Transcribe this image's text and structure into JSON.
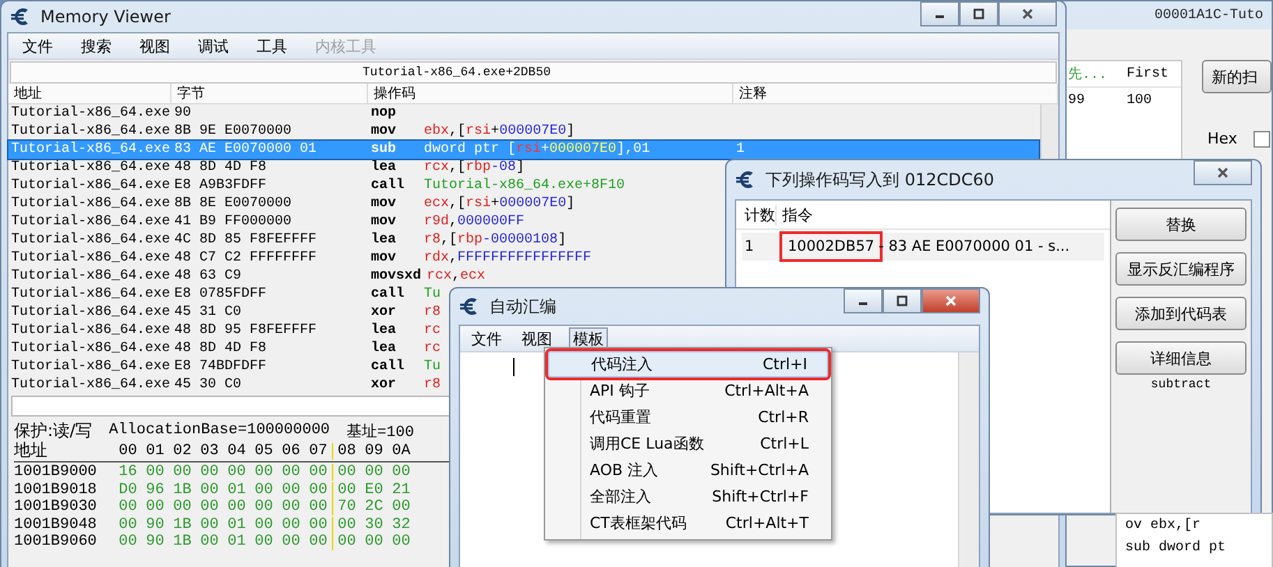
{
  "background_window": {
    "title": "00001A1C-Tuto",
    "columns": [
      "先...",
      "First"
    ],
    "row": [
      "99",
      "100"
    ],
    "button": "新的扫",
    "hex_label": "Hex",
    "hex_checked": false,
    "code_lines": [
      "ov ebx,[r",
      "sub dword pt"
    ]
  },
  "memory_viewer": {
    "title": "Memory Viewer",
    "menu": [
      {
        "label": "文件",
        "disabled": false
      },
      {
        "label": "搜索",
        "disabled": false
      },
      {
        "label": "视图",
        "disabled": false
      },
      {
        "label": "调试",
        "disabled": false
      },
      {
        "label": "工具",
        "disabled": false
      },
      {
        "label": "内核工具",
        "disabled": true
      }
    ],
    "location": "Tutorial-x86_64.exe+2DB50",
    "columns": [
      "地址",
      "字节",
      "操作码",
      "注释"
    ],
    "rows": [
      {
        "address": "Tutorial-x86_64.exe",
        "bytes": "90",
        "opcode": "nop",
        "operand": [],
        "comment": "",
        "selected": false
      },
      {
        "address": "Tutorial-x86_64.exe",
        "bytes": "8B 9E E0070000",
        "opcode": "mov",
        "operand": [
          {
            "text": "ebx",
            "kind": "reg"
          },
          {
            "text": ",[",
            "kind": "plain"
          },
          {
            "text": "rsi",
            "kind": "reg"
          },
          {
            "text": "+",
            "kind": "plain"
          },
          {
            "text": "000007E0",
            "kind": "num"
          },
          {
            "text": "]",
            "kind": "plain"
          }
        ],
        "comment": "",
        "selected": false
      },
      {
        "address": "Tutorial-x86_64.exe",
        "bytes": "83 AE E0070000 01",
        "opcode": "sub",
        "operand": [
          {
            "text": "dword ptr [",
            "kind": "plain"
          },
          {
            "text": "rsi",
            "kind": "reg"
          },
          {
            "text": "+",
            "kind": "plain"
          },
          {
            "text": "000007E0",
            "kind": "num"
          },
          {
            "text": "],01",
            "kind": "plain"
          }
        ],
        "comment": "1",
        "selected": true
      },
      {
        "address": "Tutorial-x86_64.exe",
        "bytes": "48 8D 4D F8",
        "opcode": "lea",
        "operand": [
          {
            "text": "rcx",
            "kind": "reg"
          },
          {
            "text": ",[",
            "kind": "plain"
          },
          {
            "text": "rbp",
            "kind": "reg"
          },
          {
            "text": "-08",
            "kind": "num"
          },
          {
            "text": "]",
            "kind": "plain"
          }
        ],
        "comment": "",
        "selected": false
      },
      {
        "address": "Tutorial-x86_64.exe",
        "bytes": "E8 A9B3FDFF",
        "opcode": "call",
        "operand": [
          {
            "text": "Tutorial-x86_64.exe+8F10",
            "kind": "sym"
          }
        ],
        "comment": "",
        "selected": false
      },
      {
        "address": "Tutorial-x86_64.exe",
        "bytes": "8B 8E E0070000",
        "opcode": "mov",
        "operand": [
          {
            "text": "ecx",
            "kind": "reg"
          },
          {
            "text": ",[",
            "kind": "plain"
          },
          {
            "text": "rsi",
            "kind": "reg"
          },
          {
            "text": "+",
            "kind": "plain"
          },
          {
            "text": "000007E0",
            "kind": "num"
          },
          {
            "text": "]",
            "kind": "plain"
          }
        ],
        "comment": "",
        "selected": false
      },
      {
        "address": "Tutorial-x86_64.exe",
        "bytes": "41 B9 FF000000",
        "opcode": "mov",
        "operand": [
          {
            "text": "r9d",
            "kind": "reg"
          },
          {
            "text": ",",
            "kind": "plain"
          },
          {
            "text": "000000FF",
            "kind": "num"
          }
        ],
        "comment": "",
        "selected": false
      },
      {
        "address": "Tutorial-x86_64.exe",
        "bytes": "4C 8D 85 F8FEFFFF",
        "opcode": "lea",
        "operand": [
          {
            "text": "r8",
            "kind": "reg"
          },
          {
            "text": ",[",
            "kind": "plain"
          },
          {
            "text": "rbp",
            "kind": "reg"
          },
          {
            "text": "-00000108",
            "kind": "num"
          },
          {
            "text": "]",
            "kind": "plain"
          }
        ],
        "comment": "",
        "selected": false
      },
      {
        "address": "Tutorial-x86_64.exe",
        "bytes": "48 C7 C2 FFFFFFFF",
        "opcode": "mov",
        "operand": [
          {
            "text": "rdx",
            "kind": "reg"
          },
          {
            "text": ",",
            "kind": "plain"
          },
          {
            "text": "FFFFFFFFFFFFFFFF",
            "kind": "num"
          }
        ],
        "comment": "",
        "selected": false
      },
      {
        "address": "Tutorial-x86_64.exe",
        "bytes": "48 63 C9",
        "opcode": "movsxd",
        "operand": [
          {
            "text": "rcx",
            "kind": "reg"
          },
          {
            "text": ",",
            "kind": "plain"
          },
          {
            "text": "ecx",
            "kind": "reg"
          }
        ],
        "comment": "",
        "selected": false
      },
      {
        "address": "Tutorial-x86_64.exe",
        "bytes": "E8 0785FDFF",
        "opcode": "call",
        "operand": [
          {
            "text": "Tu",
            "kind": "sym"
          }
        ],
        "comment": "",
        "selected": false
      },
      {
        "address": "Tutorial-x86_64.exe",
        "bytes": "45 31 C0",
        "opcode": "xor",
        "operand": [
          {
            "text": "r8",
            "kind": "reg"
          }
        ],
        "comment": "",
        "selected": false
      },
      {
        "address": "Tutorial-x86_64.exe",
        "bytes": "48 8D 95 F8FEFFFF",
        "opcode": "lea",
        "operand": [
          {
            "text": "rc",
            "kind": "reg"
          }
        ],
        "comment": "",
        "selected": false
      },
      {
        "address": "Tutorial-x86_64.exe",
        "bytes": "48 8D 4D F8",
        "opcode": "lea",
        "operand": [
          {
            "text": "rc",
            "kind": "reg"
          }
        ],
        "comment": "",
        "selected": false
      },
      {
        "address": "Tutorial-x86_64.exe",
        "bytes": "E8 74BDFDFF",
        "opcode": "call",
        "operand": [
          {
            "text": "Tu",
            "kind": "sym"
          }
        ],
        "comment": "",
        "selected": false
      },
      {
        "address": "Tutorial-x86_64.exe",
        "bytes": "45 30 C0",
        "opcode": "xor",
        "operand": [
          {
            "text": "r8",
            "kind": "reg"
          }
        ],
        "comment": "",
        "selected": false
      }
    ],
    "hex": {
      "info": [
        "保护:读/写",
        "AllocationBase=100000000",
        "基址=100"
      ],
      "header_label": "地址",
      "header": [
        "00",
        "01",
        "02",
        "03",
        "04",
        "05",
        "06",
        "07",
        "08",
        "09",
        "0A"
      ],
      "rows": [
        {
          "address": "1001B9000",
          "bytes": [
            "16",
            "00",
            "00",
            "00",
            "00",
            "00",
            "00",
            "00",
            "00",
            "00",
            "00"
          ]
        },
        {
          "address": "1001B9018",
          "bytes": [
            "D0",
            "96",
            "1B",
            "00",
            "01",
            "00",
            "00",
            "00",
            "00",
            "E0",
            "21"
          ]
        },
        {
          "address": "1001B9030",
          "bytes": [
            "00",
            "00",
            "00",
            "00",
            "00",
            "00",
            "00",
            "00",
            "70",
            "2C",
            "00"
          ]
        },
        {
          "address": "1001B9048",
          "bytes": [
            "00",
            "90",
            "1B",
            "00",
            "01",
            "00",
            "00",
            "00",
            "00",
            "30",
            "32"
          ]
        },
        {
          "address": "1001B9060",
          "bytes": [
            "00",
            "90",
            "1B",
            "00",
            "01",
            "00",
            "00",
            "00",
            "00",
            "00",
            "00"
          ]
        }
      ]
    }
  },
  "opcode_dialog": {
    "title": "下列操作码写入到 012CDC60",
    "columns": [
      "计数",
      "指令"
    ],
    "rows": [
      {
        "count": "1",
        "address": "10002DB57",
        "rest": " - 83 AE E0070000 01 - s...",
        "highlight_box": true
      }
    ],
    "buttons": [
      "替换",
      "显示反汇编程序",
      "添加到代码表",
      "详细信息"
    ],
    "note": "subtract"
  },
  "auto_assemble": {
    "title": "自动汇编",
    "menu": [
      {
        "label": "文件",
        "selected": false
      },
      {
        "label": "视图",
        "selected": false
      },
      {
        "label": "模板",
        "selected": true
      }
    ],
    "dropdown": [
      {
        "label": "代码注入",
        "shortcut": "Ctrl+I",
        "selected": true,
        "highlight_box": true
      },
      {
        "label": "API 钩子",
        "shortcut": "Ctrl+Alt+A",
        "selected": false,
        "highlight_box": false
      },
      {
        "label": "代码重置",
        "shortcut": "Ctrl+R",
        "selected": false,
        "highlight_box": false
      },
      {
        "label": "调用CE Lua函数",
        "shortcut": "Ctrl+L",
        "selected": false,
        "highlight_box": false
      },
      {
        "label": "AOB 注入",
        "shortcut": "Shift+Ctrl+A",
        "selected": false,
        "highlight_box": false
      },
      {
        "label": "全部注入",
        "shortcut": "Shift+Ctrl+F",
        "selected": false,
        "highlight_box": false
      },
      {
        "label": "CT表框架代码",
        "shortcut": "Ctrl+Alt+T",
        "selected": false,
        "highlight_box": false
      }
    ]
  }
}
